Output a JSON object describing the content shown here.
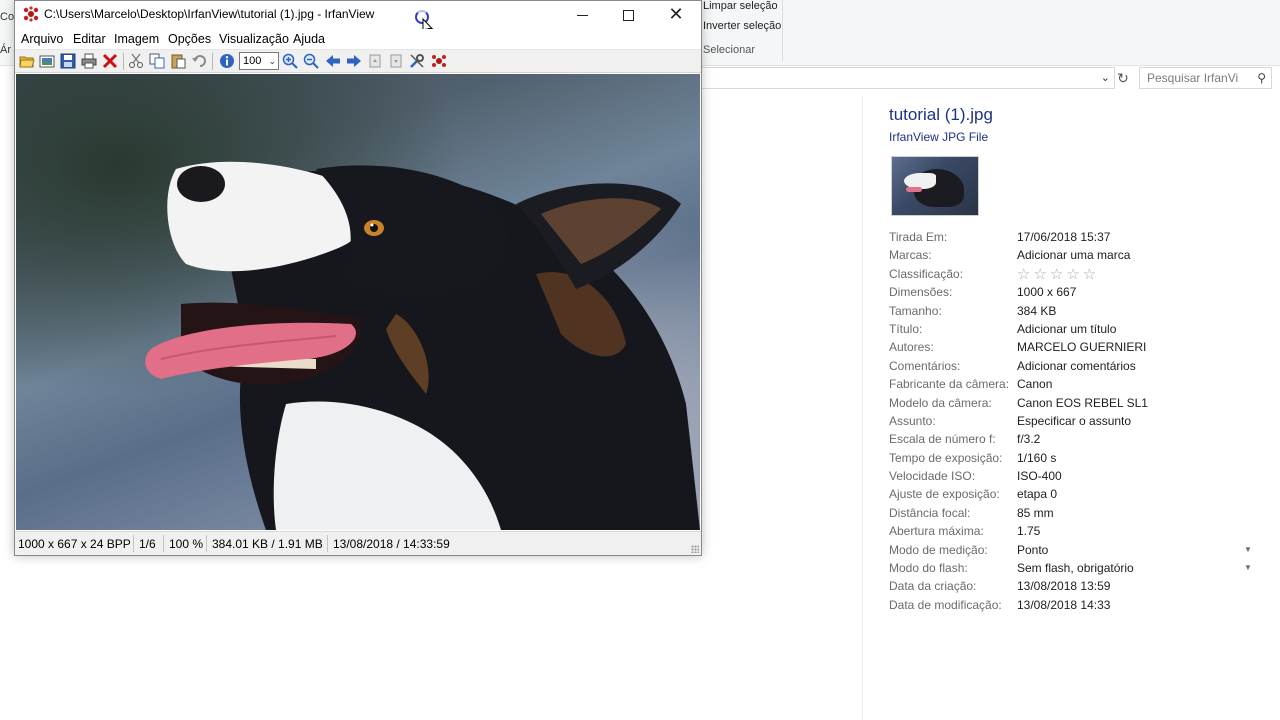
{
  "explorer": {
    "ribbon": {
      "edge_fragments": [
        "Co",
        "Ár"
      ],
      "commands": [
        "Limpar seleção",
        "Inverter seleção"
      ],
      "group_label": "Selecionar"
    },
    "search_placeholder": "Pesquisar IrfanVi",
    "details": {
      "file_name": "tutorial  (1).jpg",
      "file_type": "IrfanView JPG File",
      "properties": [
        {
          "label": "Tirada Em:",
          "value": "17/06/2018 15:37"
        },
        {
          "label": "Marcas:",
          "value": "Adicionar uma marca"
        },
        {
          "label": "Classificação:",
          "value": "☆☆☆☆☆"
        },
        {
          "label": "Dimensões:",
          "value": "1000 x 667"
        },
        {
          "label": "Tamanho:",
          "value": "384 KB"
        },
        {
          "label": "Título:",
          "value": "Adicionar um título"
        },
        {
          "label": "Autores:",
          "value": "MARCELO GUERNIERI"
        },
        {
          "label": "Comentários:",
          "value": "Adicionar comentários"
        },
        {
          "label": "Fabricante da câmera:",
          "value": "Canon"
        },
        {
          "label": "Modelo da câmera:",
          "value": "Canon EOS REBEL SL1"
        },
        {
          "label": "Assunto:",
          "value": "Especificar o assunto"
        },
        {
          "label": "Escala de número f:",
          "value": "f/3.2"
        },
        {
          "label": "Tempo de exposição:",
          "value": "1/160 s"
        },
        {
          "label": "Velocidade ISO:",
          "value": "ISO-400"
        },
        {
          "label": "Ajuste de exposição:",
          "value": "etapa 0"
        },
        {
          "label": "Distância focal:",
          "value": "85 mm"
        },
        {
          "label": "Abertura máxima:",
          "value": "1.75"
        },
        {
          "label": "Modo de medição:",
          "value": "Ponto"
        },
        {
          "label": "Modo do flash:",
          "value": "Sem flash, obrigatório"
        },
        {
          "label": "Data da criação:",
          "value": "13/08/2018 13:59"
        },
        {
          "label": "Data de modificação:",
          "value": "13/08/2018 14:33"
        }
      ]
    }
  },
  "irfanview": {
    "title": "C:\\Users\\Marcelo\\Desktop\\IrfanView\\tutorial  (1).jpg - IrfanView",
    "menu": [
      "Arquivo",
      "Editar",
      "Imagem",
      "Opções",
      "Visualização",
      "Ajuda"
    ],
    "zoom_value": "100",
    "status": [
      "1000 x 667 x 24 BPP",
      "1/6",
      "100 %",
      "384.01 KB / 1.91 MB",
      "13/08/2018 / 14:33:59"
    ]
  }
}
